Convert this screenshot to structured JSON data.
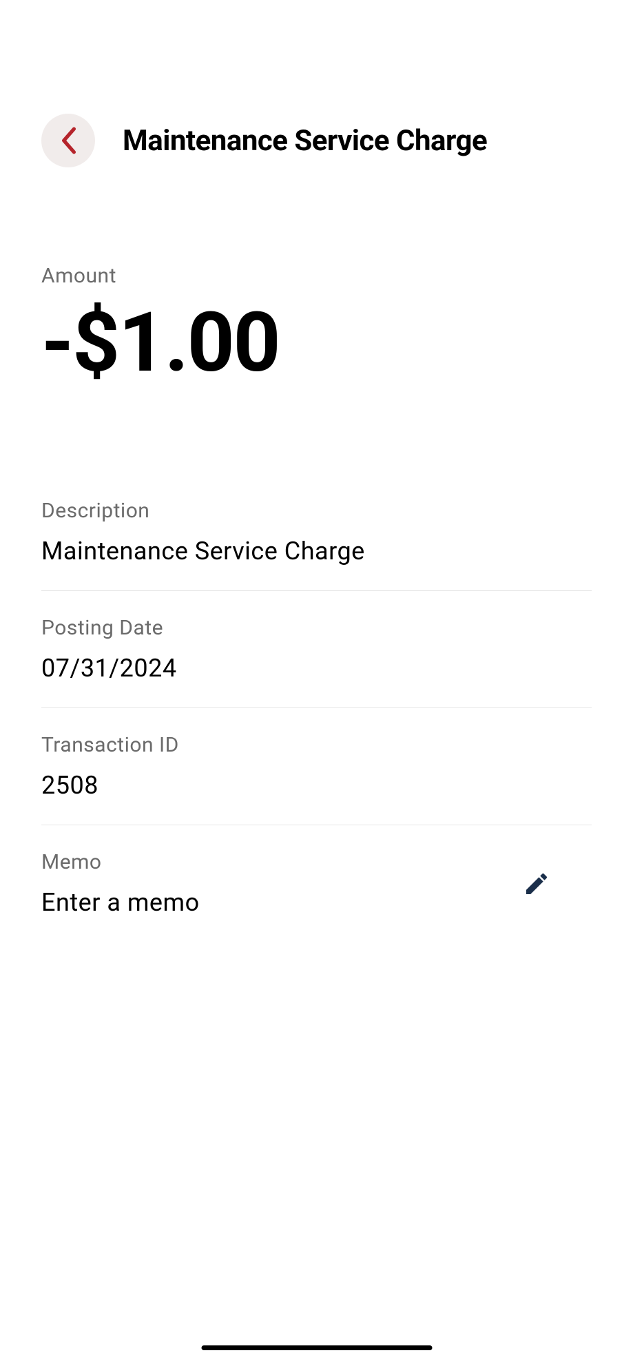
{
  "header": {
    "title": "Maintenance Service Charge"
  },
  "amount": {
    "label": "Amount",
    "value": "-$1.00"
  },
  "details": {
    "description": {
      "label": "Description",
      "value": "Maintenance Service Charge"
    },
    "posting_date": {
      "label": "Posting Date",
      "value": "07/31/2024"
    },
    "transaction_id": {
      "label": "Transaction ID",
      "value": "2508"
    },
    "memo": {
      "label": "Memo",
      "placeholder": "Enter a memo"
    }
  }
}
